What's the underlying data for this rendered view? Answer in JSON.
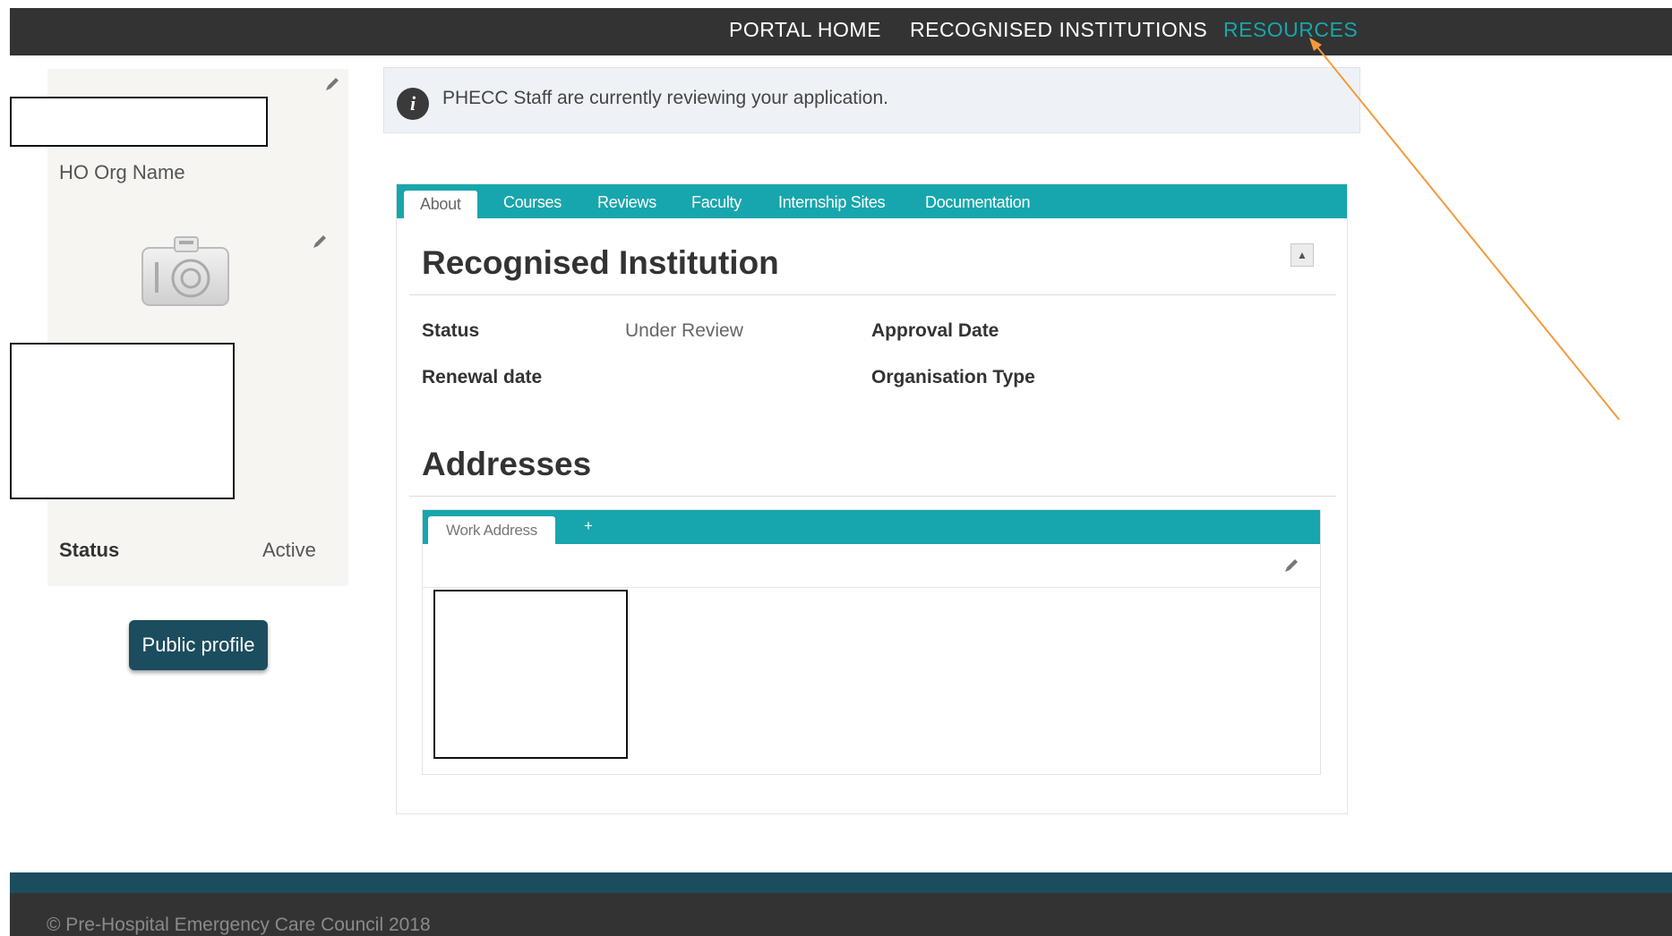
{
  "topnav": {
    "items": [
      "PORTAL HOME",
      "RECOGNISED INSTITUTIONS",
      "RESOURCES"
    ],
    "active": "RESOURCES"
  },
  "profile": {
    "org_name": "HO Org Name",
    "status_label": "Status",
    "status_value": "Active",
    "public_profile_label": "Public profile",
    "icons": [
      "pencil-icon",
      "camera-icon"
    ]
  },
  "notice": {
    "text": "PHECC Staff are currently reviewing your application.",
    "icon": "info-icon"
  },
  "tabs": [
    "About",
    "Courses",
    "Reviews",
    "Faculty",
    "Internship Sites",
    "Documentation"
  ],
  "active_tab": "About",
  "recognised_institution": {
    "title": "Recognised Institution",
    "status_label": "Status",
    "status_value": "Under Review",
    "approval_date_label": "Approval Date",
    "renewal_date_label": "Renewal date",
    "organisation_type_label": "Organisation Type",
    "collapse_symbol": "▲"
  },
  "addresses": {
    "title": "Addresses",
    "tabs": [
      "Work Address"
    ],
    "add_label": "+"
  },
  "footer": {
    "text": "© Pre-Hospital Emergency Care Council  2018"
  },
  "colors": {
    "teal": "#17a6ad",
    "dark_bar": "#333333",
    "navy": "#1b4d5e",
    "annotation_arrow": "#f29a3a"
  }
}
